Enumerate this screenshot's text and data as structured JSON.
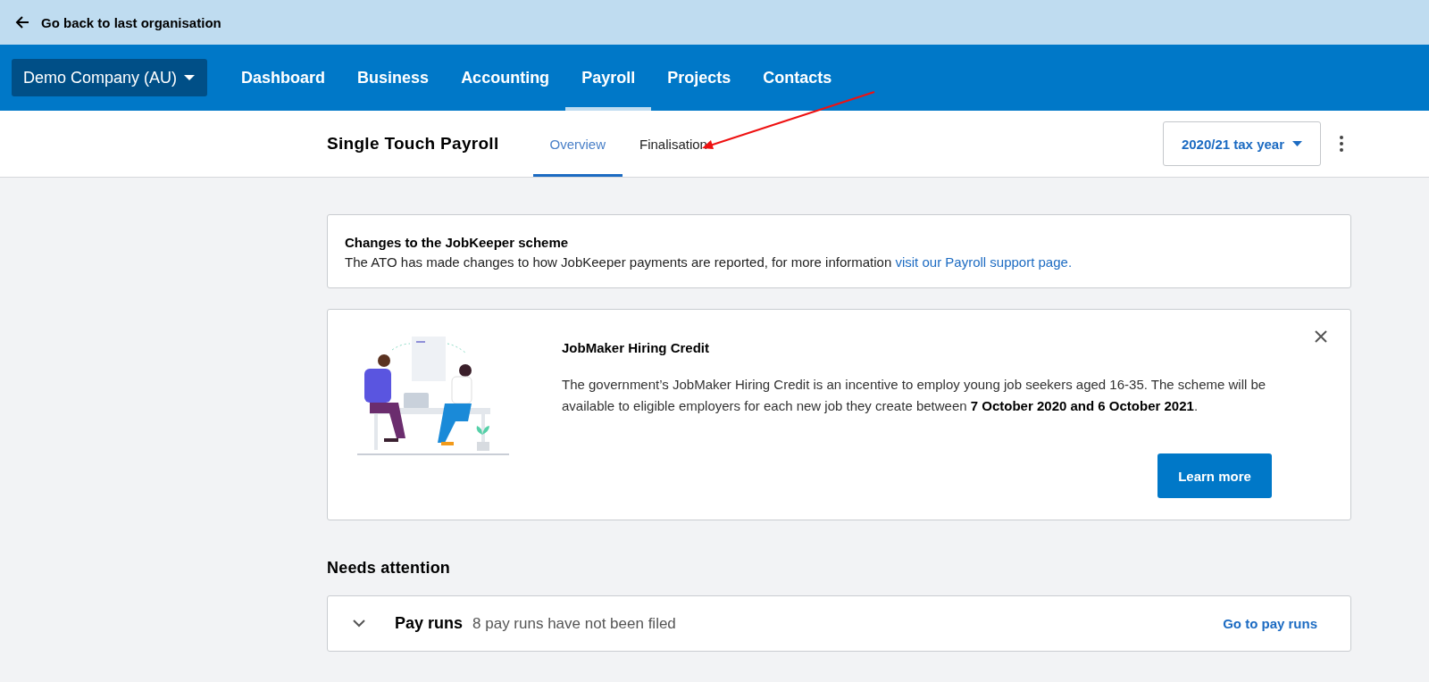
{
  "back_link": {
    "label": "Go back to last organisation"
  },
  "org_switcher": {
    "label": "Demo Company (AU)"
  },
  "nav": [
    {
      "label": "Dashboard",
      "selected": false
    },
    {
      "label": "Business",
      "selected": false
    },
    {
      "label": "Accounting",
      "selected": false
    },
    {
      "label": "Payroll",
      "selected": true
    },
    {
      "label": "Projects",
      "selected": false
    },
    {
      "label": "Contacts",
      "selected": false
    }
  ],
  "page": {
    "title": "Single Touch Payroll",
    "tabs": [
      {
        "label": "Overview",
        "selected": true
      },
      {
        "label": "Finalisation",
        "selected": false
      }
    ],
    "tax_year": "2020/21 tax year"
  },
  "notice": {
    "title": "Changes to the JobKeeper scheme",
    "text": "The ATO has made changes to how JobKeeper payments are reported, for more information ",
    "link": "visit our Payroll support page."
  },
  "promo": {
    "title": "JobMaker Hiring Credit",
    "text": "The government’s JobMaker Hiring Credit is an incentive to employ young job seekers aged 16-35. The scheme will be available to eligible employers for each new job they create between **7 October 2020 and 6 October 2021**.",
    "button": "Learn more"
  },
  "needs_attention": {
    "heading": "Needs attention",
    "items": [
      {
        "title": "Pay runs",
        "description": "8 pay runs have not been filed",
        "link": "Go to pay runs",
        "expanded": false
      }
    ]
  }
}
